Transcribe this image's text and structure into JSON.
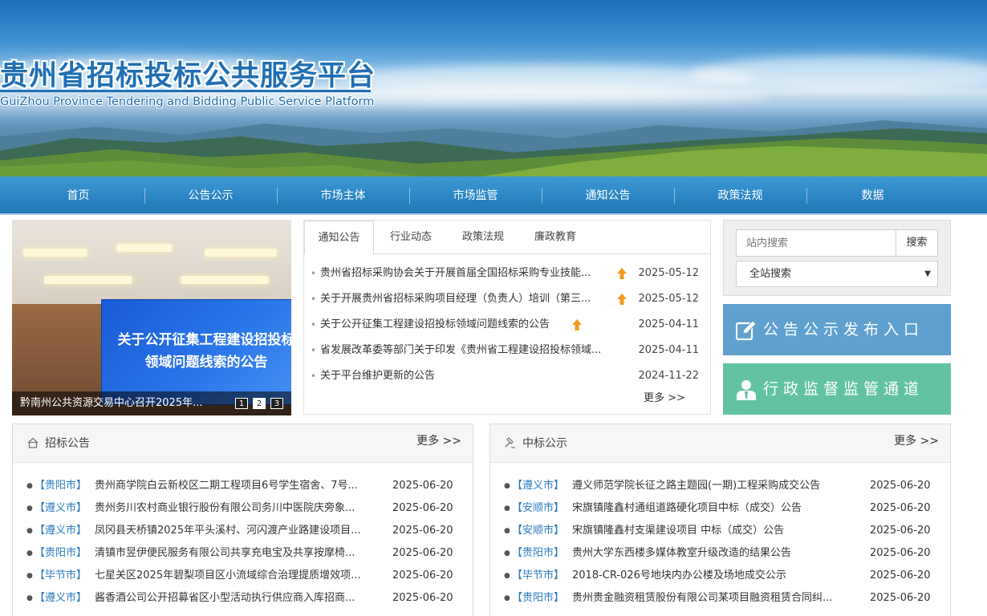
{
  "header": {
    "title_cn": "贵州省招标投标公共服务平台",
    "title_en": "GuiZhou Province Tendering and Bidding Public Service Platform"
  },
  "nav": [
    "首页",
    "公告公示",
    "市场主体",
    "市场监管",
    "通知公告",
    "政策法规",
    "数据"
  ],
  "slider": {
    "screen_text": "关于公开征集工程建设招投标领域问题线索的公告",
    "caption": "黔南州公共资源交易中心召开2025年...",
    "dots": [
      "1",
      "2",
      "3"
    ]
  },
  "notice": {
    "tabs": [
      "通知公告",
      "行业动态",
      "政策法规",
      "廉政教育"
    ],
    "active_tab": "通知公告",
    "items": [
      {
        "title": "贵州省招标采购协会关于开展首届全国招标采购专业技能...",
        "date": "2025-05-12",
        "hot": true
      },
      {
        "title": "关于开展贵州省招标采购项目经理（负责人）培训（第三...",
        "date": "2025-05-12",
        "hot": true
      },
      {
        "title": "关于公开征集工程建设招投标领域问题线索的公告",
        "date": "2025-04-11",
        "hot": true
      },
      {
        "title": "省发展改革委等部门关于印发《贵州省工程建设招投标领域...",
        "date": "2025-04-11",
        "hot": false
      },
      {
        "title": "关于平台维护更新的公告",
        "date": "2024-11-22",
        "hot": false
      }
    ],
    "more": "更多 >>"
  },
  "search": {
    "placeholder": "站内搜索",
    "button": "搜索",
    "scope": "全站搜索"
  },
  "entries": {
    "publish": "公告公示发布入口",
    "supervise": "行政监督监管通道"
  },
  "colors": {
    "nav_blue": "#2a84c3",
    "publish_blue": "#5fa0cf",
    "supervise_green": "#63c3a0",
    "city_blue": "#2b7bc1"
  },
  "tender": {
    "title": "招标公告",
    "more": "更多 >>",
    "items": [
      {
        "city": "【贵阳市】",
        "text": "贵州商学院白云新校区二期工程项目6号学生宿舍、7号...",
        "date": "2025-06-20"
      },
      {
        "city": "【遵义市】",
        "text": "贵州务川农村商业银行股份有限公司务川中医院庆旁象...",
        "date": "2025-06-20"
      },
      {
        "city": "【遵义市】",
        "text": "凤冈县天桥镇2025年平头溪村、河闪渡产业路建设项目...",
        "date": "2025-06-20"
      },
      {
        "city": "【贵阳市】",
        "text": "清镇市昱伊便民服务有限公司共享充电宝及共享按摩椅...",
        "date": "2025-06-20"
      },
      {
        "city": "【毕节市】",
        "text": "七星关区2025年碧梨项目区小流域综合治理提质增效项...",
        "date": "2025-06-20"
      },
      {
        "city": "【遵义市】",
        "text": "酱香酒公司公开招募省区小型活动执行供应商入库招商...",
        "date": "2025-06-20"
      }
    ]
  },
  "award": {
    "title": "中标公示",
    "more": "更多 >>",
    "items": [
      {
        "city": "【遵义市】",
        "text": "遵义师范学院长征之路主题园(一期)工程采购成交公告",
        "date": "2025-06-20"
      },
      {
        "city": "【安顺市】",
        "text": "宋旗镇隆鑫村通组道路硬化项目中标（成交）公告",
        "date": "2025-06-20"
      },
      {
        "city": "【安顺市】",
        "text": "宋旗镇隆鑫村支渠建设项目 中标（成交）公告",
        "date": "2025-06-20"
      },
      {
        "city": "【贵阳市】",
        "text": "贵州大学东西楼多媒体教室升级改造的结果公告",
        "date": "2025-06-20"
      },
      {
        "city": "【毕节市】",
        "text": "2018-CR-026号地块内办公楼及场地成交公示",
        "date": "2025-06-20"
      },
      {
        "city": "【贵阳市】",
        "text": "贵州贵金融资租赁股份有限公司某项目融资租赁合同纠...",
        "date": "2025-06-20"
      }
    ]
  }
}
